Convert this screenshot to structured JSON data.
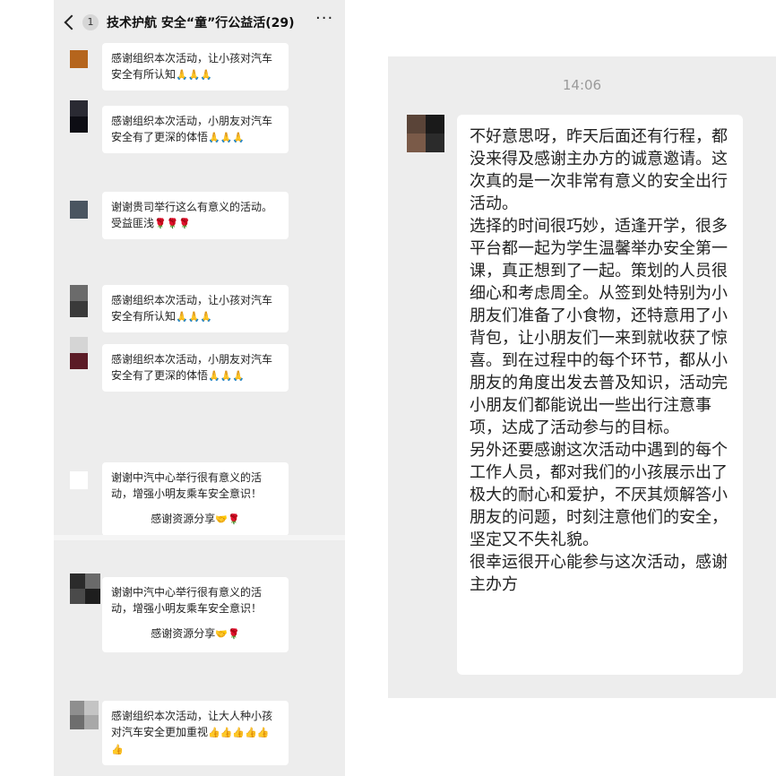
{
  "left_chat": {
    "header": {
      "back_count": "1",
      "title": "技术护航 安全“童”行公益活",
      "member_count": "(29)",
      "more_icon": "ellipsis-icon"
    },
    "messages": [
      {
        "text": "感谢组织本次活动，让小孩对汽车安全有所认知",
        "emoji": "🙏🙏🙏",
        "avatar_colors": [
          "#b5651d"
        ]
      },
      {
        "text": "感谢组织本次活动，小朋友对汽车安全有了更深的体悟",
        "emoji": "🙏🙏🙏",
        "avatar_colors": [
          "#2a2a33",
          "#0d0d14"
        ]
      },
      {
        "text": "谢谢贵司举行这么有意义的活动。受益匪浅",
        "emoji": "🌹🌹🌹",
        "avatar_colors": [
          "#4a5560"
        ]
      },
      {
        "text": "感谢组织本次活动，让小孩对汽车安全有所认知",
        "emoji": "🙏🙏🙏",
        "avatar_colors": [
          "#6b6b6b",
          "#3a3a3a"
        ]
      },
      {
        "text": "感谢组织本次活动，小朋友对汽车安全有了更深的体悟",
        "emoji": "🙏🙏🙏",
        "avatar_colors": [
          "#d5d5d5",
          "#5b1b26"
        ]
      },
      {
        "text": "谢谢中汽中心举行很有意义的活动，增强小明友乘车安全意识！",
        "caption": "感谢资源分享",
        "emoji": "🤝🌹",
        "avatar_colors": [
          "#ffffff"
        ]
      },
      {
        "text": "谢谢中汽中心举行很有意义的活动，增强小明友乘车安全意识！",
        "caption": "感谢资源分享",
        "emoji": "🤝🌹",
        "avatar_colors": [
          "#2b2b2b",
          "#6a6a6a",
          "#4a4a4a",
          "#1e1e1e"
        ]
      },
      {
        "text": "感谢组织本次活动，让大人种小孩对汽车安全更加重视",
        "emoji": "👍👍👍👍👍👍",
        "avatar_colors": [
          "#8f8f8f",
          "#c4c4c4",
          "#6e6e6e",
          "#a8a8a8"
        ]
      }
    ]
  },
  "right_chat": {
    "timestamp": "14:06",
    "avatar_colors": [
      "#5a4438",
      "#1a1a1a",
      "#7a5a48",
      "#2b2b2b"
    ],
    "message": "不好意思呀，昨天后面还有行程，都没来得及感谢主办方的诚意邀请。这次真的是一次非常有意义的安全出行活动。\n选择的时间很巧妙，适逢开学，很多平台都一起为学生温馨举办安全第一课，真正想到了一起。策划的人员很细心和考虑周全。从签到处特别为小朋友们准备了小食物，还特意用了小背包，让小朋友们一来到就收获了惊喜。到在过程中的每个环节，都从小朋友的角度出发去普及知识，活动完小朋友们都能说出一些出行注意事项，达成了活动参与的目标。\n另外还要感谢这次活动中遇到的每个工作人员，都对我们的小孩展示出了极大的耐心和爱护，不厌其烦解答小朋友的问题，时刻注意他们的安全，坚定又不失礼貌。\n很幸运很开心能参与这次活动，感谢主办方"
  }
}
